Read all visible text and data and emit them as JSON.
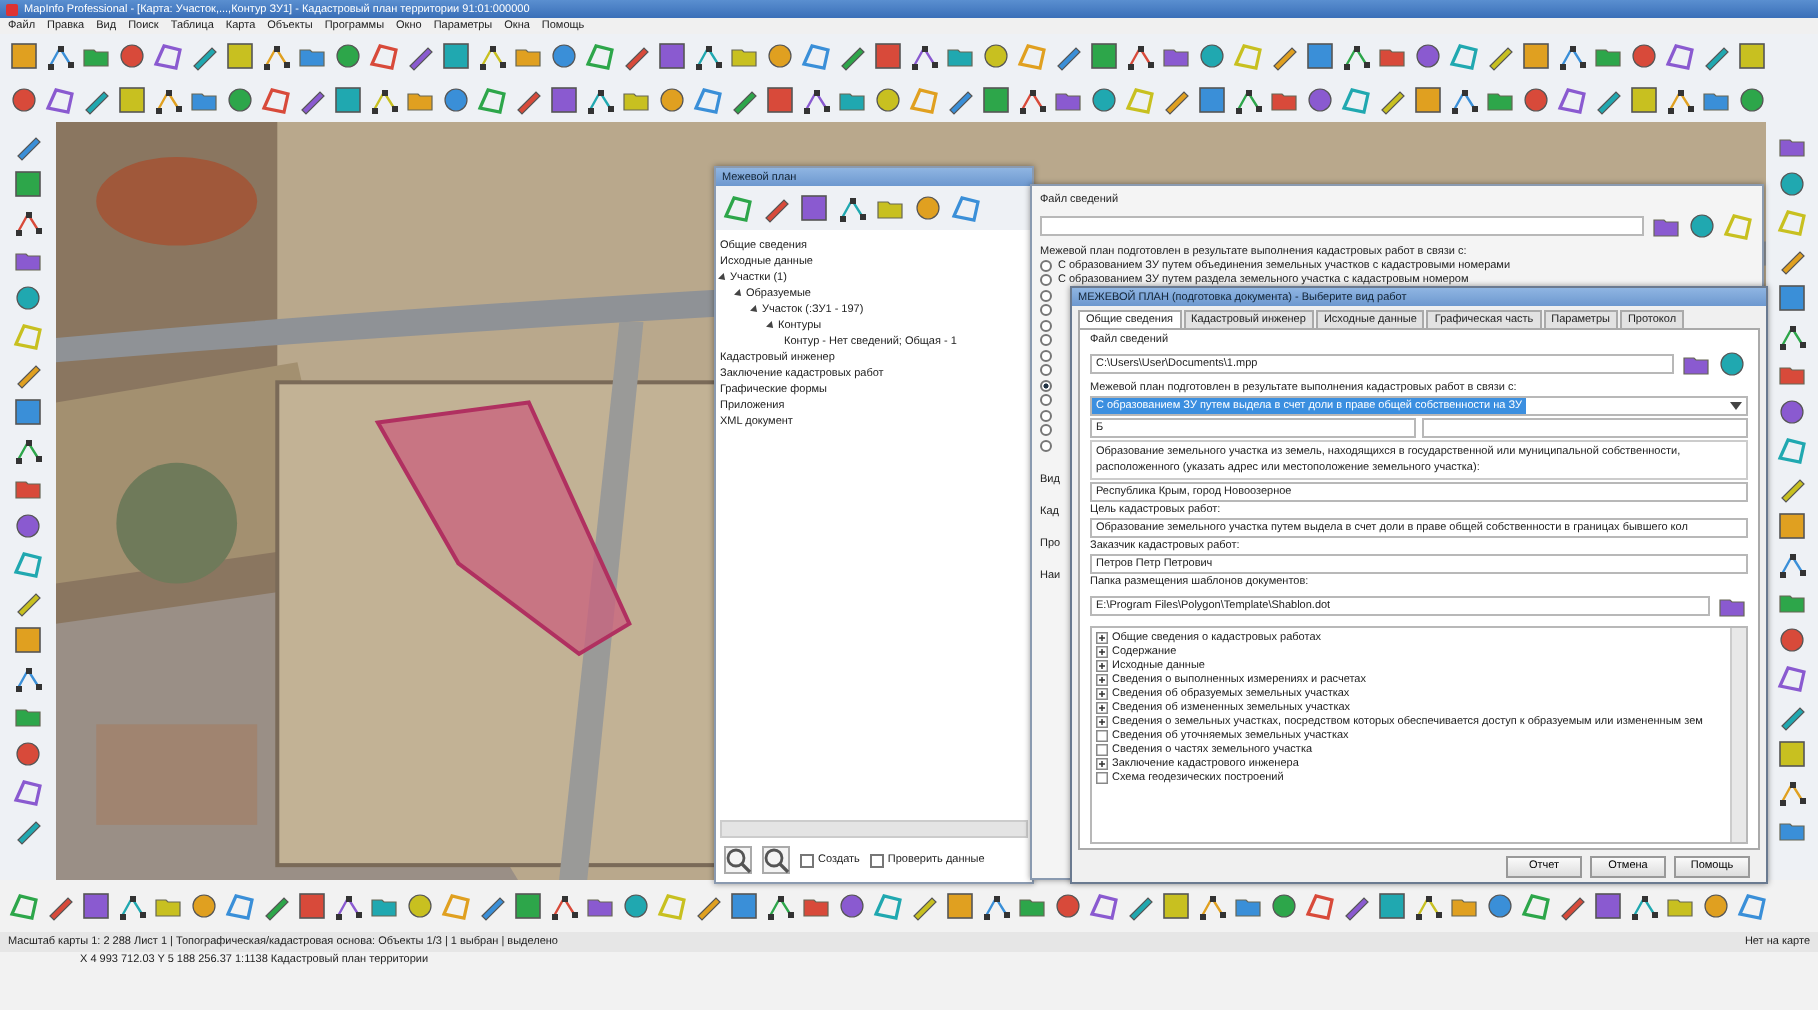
{
  "window": {
    "title": "MapInfo Professional - [Карта: Участок,...,Контур ЗУ1] - Кадастровый план территории 91:01:000000"
  },
  "menu": [
    "Файл",
    "Правка",
    "Вид",
    "Поиск",
    "Таблица",
    "Карта",
    "Объекты",
    "Программы",
    "Окно",
    "Параметры",
    "Окна",
    "Помощь"
  ],
  "tree_panel": {
    "title": "Межевой план",
    "items": [
      {
        "label": "Общие сведения"
      },
      {
        "label": "Исходные данные"
      },
      {
        "label": "Участки (1)",
        "expanded": true,
        "children": [
          {
            "label": "Образуемые",
            "expanded": true,
            "children": [
              {
                "label": "Участок (:ЗУ1 - 197)",
                "expanded": true,
                "children": [
                  {
                    "label": "Контуры",
                    "expanded": true,
                    "children": [
                      {
                        "label": "Контур - Нет сведений; Общая - 1"
                      }
                    ]
                  }
                ]
              }
            ]
          }
        ]
      },
      {
        "label": "Кадастровый инженер"
      },
      {
        "label": "Заключение кадастровых работ"
      },
      {
        "label": "Графические формы"
      },
      {
        "label": "Приложения"
      },
      {
        "label": "XML документ"
      }
    ],
    "options": [
      {
        "label": "Создать",
        "checked": false
      },
      {
        "label": "Проверить данные",
        "checked": false
      }
    ]
  },
  "plan_form": {
    "file_label": "Файл сведений",
    "heading": "Межевой план подготовлен в результате выполнения кадастровых работ в связи с:",
    "radios": [
      {
        "label": "С образованием ЗУ путем объединения земельных участков с кадастровыми номерами",
        "selected": false
      },
      {
        "label": "С образованием ЗУ путем раздела земельного участка с кадастровым номером",
        "selected": false
      },
      {
        "selected": false
      },
      {
        "selected": false
      },
      {
        "selected": false
      },
      {
        "selected": false
      },
      {
        "selected": false
      },
      {
        "selected": false
      },
      {
        "selected": true
      },
      {
        "selected": false
      },
      {
        "selected": false
      },
      {
        "selected": false
      },
      {
        "selected": false
      }
    ],
    "side_labels": [
      "Вид",
      "Кад",
      "Про",
      "Наи"
    ]
  },
  "dialog": {
    "title": "МЕЖЕВОЙ ПЛАН (подготовка документа) - Выберите вид работ",
    "tabs": [
      {
        "label": "Общие сведения",
        "selected": true
      },
      {
        "label": "Кадастровый инженер",
        "selected": false
      },
      {
        "label": "Исходные данные",
        "selected": false
      },
      {
        "label": "Графическая часть",
        "selected": false
      },
      {
        "label": "Параметры",
        "selected": false
      },
      {
        "label": "Протокол",
        "selected": false
      }
    ],
    "file_label": "Файл сведений",
    "file_value": "C:\\Users\\User\\Documents\\1.mpp",
    "reason_label": "Межевой план подготовлен в результате выполнения кадастровых работ в связи с:",
    "reason_value": "С образованием ЗУ путем выдела в счет доли в праве общей собственности на ЗУ",
    "code_value": "Б",
    "location_label": "Образование земельного участка из земель, находящихся в государственной или муниципальной собственности, расположенного (указать адрес или местоположение земельного участка):",
    "location_value": "Республика Крым, город Новоозерное",
    "purpose_label": "Цель кадастровых работ:",
    "purpose_value": "Образование земельного участка путем выдела в счет доли в праве общей собственности в границах бывшего кол",
    "customer_label": "Заказчик кадастровых работ:",
    "customer_value": "Петров Петр Петрович",
    "template_label": "Папка размещения шаблонов документов:",
    "template_value": "E:\\Program Files\\Polygon\\Template\\Shablon.dot",
    "sections": [
      {
        "label": "Общие сведения о кадастровых работах",
        "kind": "group"
      },
      {
        "label": "Содержание",
        "kind": "group"
      },
      {
        "label": "Исходные данные",
        "kind": "group"
      },
      {
        "label": "Сведения о выполненных измерениях и расчетах",
        "kind": "group"
      },
      {
        "label": "Сведения об образуемых земельных участках",
        "kind": "group"
      },
      {
        "label": "Сведения об измененных земельных участках",
        "kind": "group"
      },
      {
        "label": "Сведения о земельных участках, посредством которых обеспечивается доступ к образуемым или измененным зем",
        "kind": "group"
      },
      {
        "label": "Сведения об уточняемых земельных участках",
        "kind": "leaf"
      },
      {
        "label": "Сведения о частях земельного участка",
        "kind": "leaf"
      },
      {
        "label": "Заключение кадастрового инженера",
        "kind": "group"
      },
      {
        "label": "Схема геодезических построений",
        "kind": "leaf"
      }
    ],
    "buttons": [
      "Отчет",
      "Отмена",
      "Помощь"
    ]
  },
  "status_bar": {
    "left": "Масштаб карты 1: 2 288 Лист 1 | Топографическая/кадастровая основа: Объекты 1/3 | 1 выбран | выделено",
    "right": "Нет на карте",
    "coords": "X 4 993 712.03   Y 5 188 256.37          1:1138          Кадастровый план территории"
  }
}
